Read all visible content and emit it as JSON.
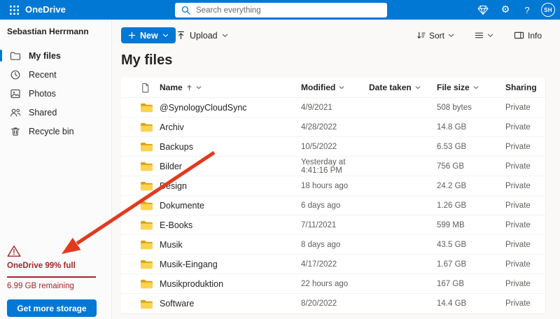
{
  "header": {
    "app_name": "OneDrive",
    "search_placeholder": "Search everything",
    "avatar_initials": "SH",
    "icons": {
      "gear_glyph": "⚙",
      "help_glyph": "?"
    }
  },
  "sidebar": {
    "user_name": "Sebastian Herrmann",
    "items": [
      {
        "label": "My files",
        "selected": true
      },
      {
        "label": "Recent",
        "selected": false
      },
      {
        "label": "Photos",
        "selected": false
      },
      {
        "label": "Shared",
        "selected": false
      },
      {
        "label": "Recycle bin",
        "selected": false
      }
    ],
    "storage": {
      "warning": "OneDrive 99% full",
      "percent_full": 99,
      "remaining": "6.99 GB remaining",
      "button_label": "Get more storage"
    }
  },
  "toolbar": {
    "new_label": "New",
    "upload_label": "Upload",
    "sort_label": "Sort",
    "info_label": "Info"
  },
  "main": {
    "title": "My files",
    "table": {
      "columns": [
        "Name",
        "Modified",
        "Date taken",
        "File size",
        "Sharing"
      ],
      "rows": [
        {
          "name": "@SynologyCloudSync",
          "modified": "4/9/2021",
          "date_taken": "",
          "size": "508 bytes",
          "sharing": "Private"
        },
        {
          "name": "Archiv",
          "modified": "4/28/2022",
          "date_taken": "",
          "size": "14.8 GB",
          "sharing": "Private"
        },
        {
          "name": "Backups",
          "modified": "10/5/2022",
          "date_taken": "",
          "size": "6.53 GB",
          "sharing": "Private"
        },
        {
          "name": "Bilder",
          "modified": "Yesterday at 4:41:16 PM",
          "date_taken": "",
          "size": "756 GB",
          "sharing": "Private"
        },
        {
          "name": "Design",
          "modified": "18 hours ago",
          "date_taken": "",
          "size": "24.2 GB",
          "sharing": "Private"
        },
        {
          "name": "Dokumente",
          "modified": "6 days ago",
          "date_taken": "",
          "size": "1.26 GB",
          "sharing": "Private"
        },
        {
          "name": "E-Books",
          "modified": "7/11/2021",
          "date_taken": "",
          "size": "599 MB",
          "sharing": "Private"
        },
        {
          "name": "Musik",
          "modified": "8 days ago",
          "date_taken": "",
          "size": "43.5 GB",
          "sharing": "Private"
        },
        {
          "name": "Musik-Eingang",
          "modified": "4/17/2022",
          "date_taken": "",
          "size": "1.67 GB",
          "sharing": "Private"
        },
        {
          "name": "Musikproduktion",
          "modified": "22 hours ago",
          "date_taken": "",
          "size": "167 GB",
          "sharing": "Private"
        },
        {
          "name": "Software",
          "modified": "8/20/2022",
          "date_taken": "",
          "size": "14.4 GB",
          "sharing": "Private"
        }
      ]
    }
  },
  "annotation": {
    "arrow_color": "#e23a1e"
  },
  "colors": {
    "header_blue": "#0078d4",
    "accent_blue": "#0078d4",
    "warning_red": "#a4262c",
    "folder_front": "#fed34e",
    "folder_back": "#d9a011"
  }
}
